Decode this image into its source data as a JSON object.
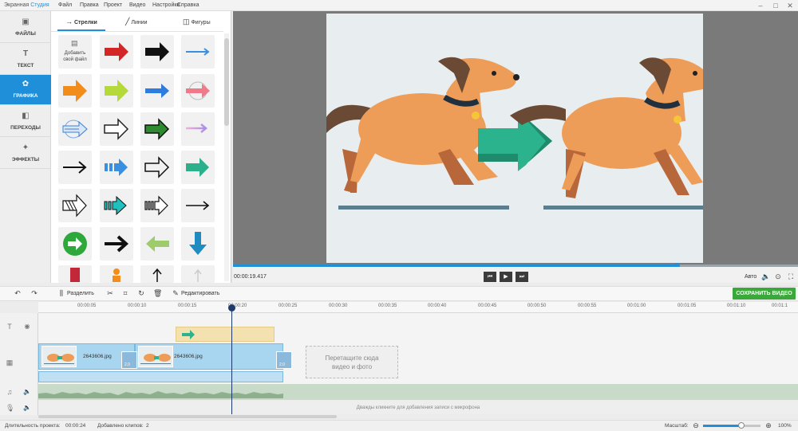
{
  "app": {
    "title_prefix": "Экранная ",
    "title_accent": "Студия"
  },
  "menu": [
    "Файл",
    "Правка",
    "Проект",
    "Видео",
    "Настройки",
    "Справка"
  ],
  "window_controls": [
    "–",
    "□",
    "✕"
  ],
  "nav": [
    {
      "label": "ФАЙЛЫ",
      "icon": "files-icon",
      "active": false
    },
    {
      "label": "ТЕКСТ",
      "icon": "text-icon",
      "active": false
    },
    {
      "label": "ГРАФИКА",
      "icon": "graphics-icon",
      "active": true
    },
    {
      "label": "ПЕРЕХОДЫ",
      "icon": "transitions-icon",
      "active": false
    },
    {
      "label": "ЭФФЕКТЫ",
      "icon": "effects-icon",
      "active": false
    }
  ],
  "library": {
    "tabs": [
      "Стрелки",
      "Линии",
      "Фигуры"
    ],
    "active_tab": "Стрелки",
    "add_file_label_1": "Добавить",
    "add_file_label_2": "свой файл"
  },
  "preview": {
    "time": "00:00:19.417",
    "auto_label": "Авто",
    "progress": 0.785
  },
  "toolbar": {
    "split_label": "Разделить",
    "edit_label": "Редактировать",
    "save_label": "СОХРАНИТЬ ВИДЕО"
  },
  "ruler": [
    "00:00:05",
    "00:00:10",
    "00:00:15",
    "00:00:20",
    "00:00:25",
    "00:00:30",
    "00:00:35",
    "00:00:40",
    "00:00:45",
    "00:00:50",
    "00:00:55",
    "00:01:00",
    "00:01:05",
    "00:01:10",
    "00:01:1"
  ],
  "clips": [
    {
      "name": "2643606.jpg"
    },
    {
      "name": "2643606.jpg"
    }
  ],
  "transition_labels": [
    "2.0",
    "2.0"
  ],
  "dropzone": {
    "line1": "Перетащите сюда",
    "line2": "видео и фото"
  },
  "mic_message": "Дважды кликните для добавления записи с микрофона",
  "status": {
    "duration_label": "Длительность проекта:",
    "duration_value": "00:00:24",
    "clips_label": "Добавлено клипов:",
    "clips_value": "2",
    "zoom_label": "Масштаб:",
    "zoom_value": "100%"
  },
  "colors": {
    "accent": "#1e8fd8",
    "save": "#3ca83c",
    "playhead": "#1d3a6a"
  }
}
